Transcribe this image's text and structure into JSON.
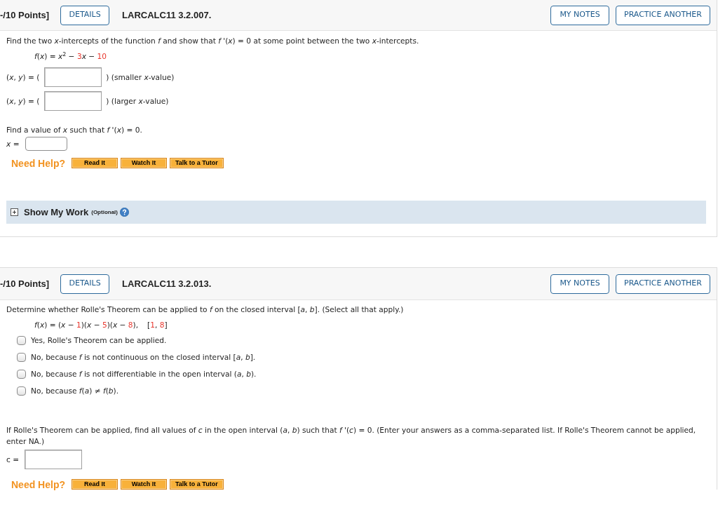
{
  "questions": [
    {
      "header": {
        "points": "-/10 Points]",
        "details": "DETAILS",
        "code": "LARCALC11 3.2.007.",
        "my_notes": "MY NOTES",
        "practice": "PRACTICE ANOTHER"
      },
      "prompt": "Find the two *x*-intercepts of the function *f* and show that *f* '(*x*) = 0 at some point between the two *x*-intercepts.",
      "formula": [
        {
          "kind": "text",
          "text": "*f*(*x*) = *x*$^{2}$ − "
        },
        {
          "kind": "value",
          "text": "3"
        },
        {
          "kind": "text",
          "text": "*x* − "
        },
        {
          "kind": "value",
          "text": "10"
        }
      ],
      "answers": [
        {
          "before": "(*x*, *y*) = (",
          "after": ") (smaller *x*-value)"
        },
        {
          "before": "(*x*, *y*) = (",
          "after": ") (larger *x*-value)"
        }
      ],
      "followup": "Find a value of *x* such that *f* '(*x*) = 0.",
      "followup_answer": {
        "kind": "inline",
        "label": "*x* ="
      },
      "help": {
        "label": "Need Help?",
        "buttons": [
          "Read It",
          "Watch It",
          "Talk to a Tutor"
        ]
      },
      "show_my_work": {
        "label": "Show My Work",
        "note": "(Optional)"
      }
    },
    {
      "header": {
        "points": "-/10 Points]",
        "details": "DETAILS",
        "code": "LARCALC11 3.2.013.",
        "my_notes": "MY NOTES",
        "practice": "PRACTICE ANOTHER"
      },
      "prompt": "Determine whether Rolle's Theorem can be applied to *f* on the closed interval [*a*, *b*]. (Select all that apply.)",
      "formula": [
        {
          "kind": "text",
          "text": "*f*(*x*) = (*x* − "
        },
        {
          "kind": "value",
          "text": "1"
        },
        {
          "kind": "text",
          "text": ")(*x* − "
        },
        {
          "kind": "value",
          "text": "5"
        },
        {
          "kind": "text",
          "text": ")(*x* − "
        },
        {
          "kind": "value",
          "text": "8"
        },
        {
          "kind": "text",
          "text": "),"
        }
      ],
      "interval": [
        {
          "kind": "text",
          "text": "["
        },
        {
          "kind": "value",
          "text": "1"
        },
        {
          "kind": "text",
          "text": ", "
        },
        {
          "kind": "value",
          "text": "8"
        },
        {
          "kind": "text",
          "text": "]"
        }
      ],
      "options": [
        {
          "label": "Yes, Rolle's Theorem can be applied.",
          "checked": false
        },
        {
          "label": "No, because *f* is not continuous on the closed interval [*a*, *b*].",
          "checked": false
        },
        {
          "label": "No, because *f* is not differentiable in the open interval (*a*, *b*).",
          "checked": false
        },
        {
          "label": "No, because *f*(*a*) ≠ *f*(*b*).",
          "checked": false
        }
      ],
      "followup": "If Rolle's Theorem can be applied, find all values of *c* in the open interval (*a*, *b*) such that *f* '(*c*) = 0. (Enter your answers as a comma-separated list. If Rolle's Theorem cannot be applied, enter NA.)",
      "followup_answer": {
        "kind": "box",
        "label": "c ="
      },
      "help": {
        "label": "Need Help?",
        "buttons": [
          "Read It",
          "Watch It",
          "Talk to a Tutor"
        ]
      }
    }
  ]
}
